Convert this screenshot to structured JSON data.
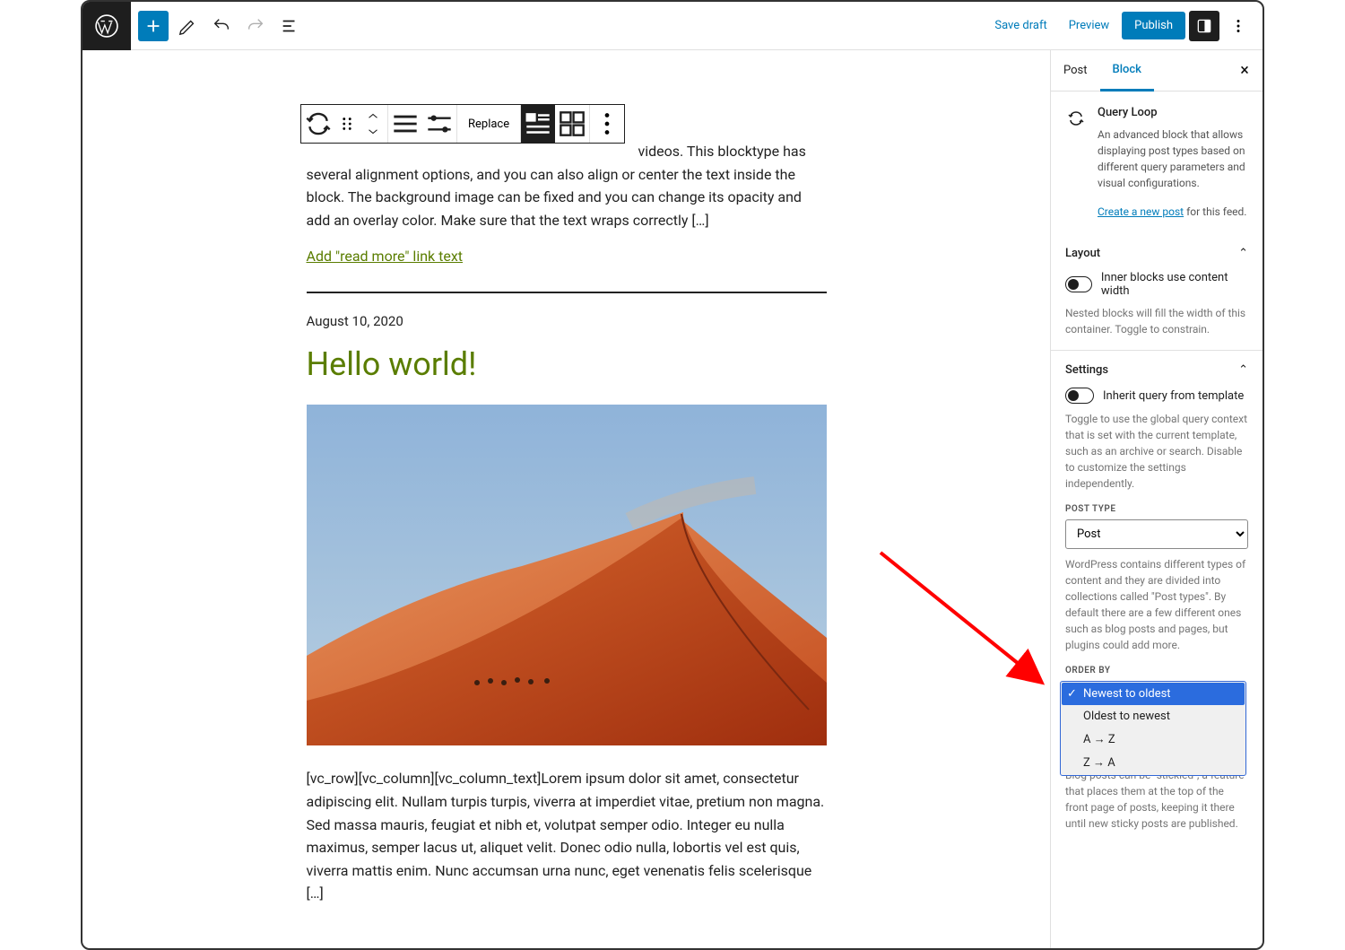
{
  "topbar": {
    "save_draft": "Save draft",
    "preview": "Preview",
    "publish": "Publish"
  },
  "block_toolbar": {
    "replace": "Replace"
  },
  "content": {
    "excerpt_1": "videos. This blocktype has several alignment options, and you can also align or center the text inside the block. The background image can be fixed and you can change its opacity and add an overlay color. Make sure that the text wraps correctly […]",
    "read_more": "Add \"read more\" link text",
    "post_date": "August 10, 2020",
    "post_title": "Hello world!",
    "excerpt_2": "[vc_row][vc_column][vc_column_text]Lorem ipsum dolor sit amet, consectetur adipiscing elit. Nullam turpis turpis, viverra at imperdiet vitae, pretium non magna. Sed massa mauris, feugiat et nibh et, volutpat semper odio. Integer eu nulla maximus, semper lacus ut, aliquet velit. Donec odio nulla, lobortis vel est quis, viverra mattis enim. Nunc accumsan urna nunc, eget venenatis felis scelerisque […]"
  },
  "sidebar": {
    "tab_post": "Post",
    "tab_block": "Block",
    "block_name": "Query Loop",
    "block_desc": "An advanced block that allows displaying post types based on different query parameters and visual configurations.",
    "create_post_link": "Create a new post",
    "create_post_suffix": " for this feed.",
    "layout_title": "Layout",
    "layout_toggle_label": "Inner blocks use content width",
    "layout_help": "Nested blocks will fill the width of this container. Toggle to constrain.",
    "settings_title": "Settings",
    "inherit_label": "Inherit query from template",
    "inherit_help": "Toggle to use the global query context that is set with the current template, such as an archive or search. Disable to customize the settings independently.",
    "post_type_label": "POST TYPE",
    "post_type_value": "Post",
    "post_type_help": "WordPress contains different types of content and they are divided into collections called \"Post types\". By default there are a few different ones such as blog posts and pages, but plugins could add more.",
    "order_by_label": "ORDER BY",
    "order_options": {
      "newest": "Newest to oldest",
      "oldest": "Oldest to newest",
      "az": "A → Z",
      "za": "Z → A"
    },
    "sticky_help": "Blog posts can be \"stickied\", a feature that places them at the top of the front page of posts, keeping it there until new sticky posts are published."
  }
}
